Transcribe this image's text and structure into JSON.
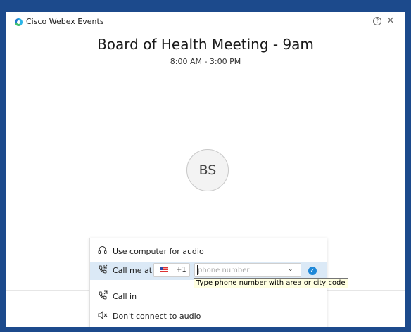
{
  "window": {
    "app_title": "Cisco Webex Events",
    "help_glyph": "?",
    "close_glyph": "×"
  },
  "meeting": {
    "title": "Board of Health Meeting - 9am",
    "time": "8:00 AM - 3:00 PM",
    "avatar_initials": "BS"
  },
  "audio_menu": {
    "items": [
      {
        "label": "Use computer for audio",
        "icon": "headset-icon"
      },
      {
        "label": "Call me at",
        "icon": "phone-callback-icon",
        "selected": true
      },
      {
        "label": "Call in",
        "icon": "phone-call-in-icon"
      },
      {
        "label": "Don't connect to audio",
        "icon": "speaker-muted-icon"
      }
    ],
    "call_me": {
      "country_flag": "us-flag-icon",
      "country_code": "+1",
      "phone_value": "",
      "phone_placeholder": "phone number"
    }
  },
  "tooltip": {
    "text": "Type phone number with area or city code"
  },
  "colors": {
    "background": "#1c4a8c",
    "selected_row": "#dbe9f6",
    "accent": "#1e88d8"
  }
}
